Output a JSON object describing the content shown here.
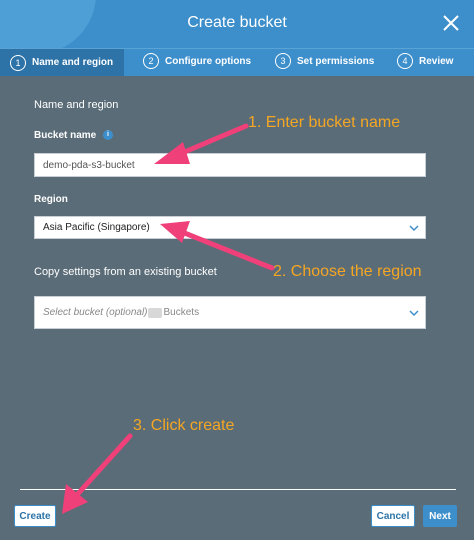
{
  "header": {
    "title": "Create bucket"
  },
  "steps": [
    {
      "number": "1",
      "label": "Name and region"
    },
    {
      "number": "2",
      "label": "Configure options"
    },
    {
      "number": "3",
      "label": "Set permissions"
    },
    {
      "number": "4",
      "label": "Review"
    }
  ],
  "form": {
    "section_title": "Name and region",
    "bucket_name_label": "Bucket name",
    "bucket_name_value": "demo-pda-s3-bucket",
    "region_label": "Region",
    "region_value": "Asia Pacific (Singapore)",
    "copy_settings_label": "Copy settings from an existing bucket",
    "copy_settings_placeholder": "Select bucket (optional)",
    "copy_settings_suffix": "Buckets"
  },
  "footer": {
    "create_label": "Create",
    "cancel_label": "Cancel",
    "next_label": "Next"
  },
  "annotations": {
    "step1": "1. Enter bucket name",
    "step2": "2. Choose the region",
    "step3": "3. Click create"
  },
  "colors": {
    "header_blue": "#3d8fcb",
    "active_step": "#2d73a8",
    "body_slate": "#5a6c77",
    "annotation_orange": "#f5a623",
    "arrow_pink": "#f0407a"
  },
  "icons": {
    "close": "close-icon",
    "info": "info-icon",
    "chevron": "chevron-down-icon"
  }
}
